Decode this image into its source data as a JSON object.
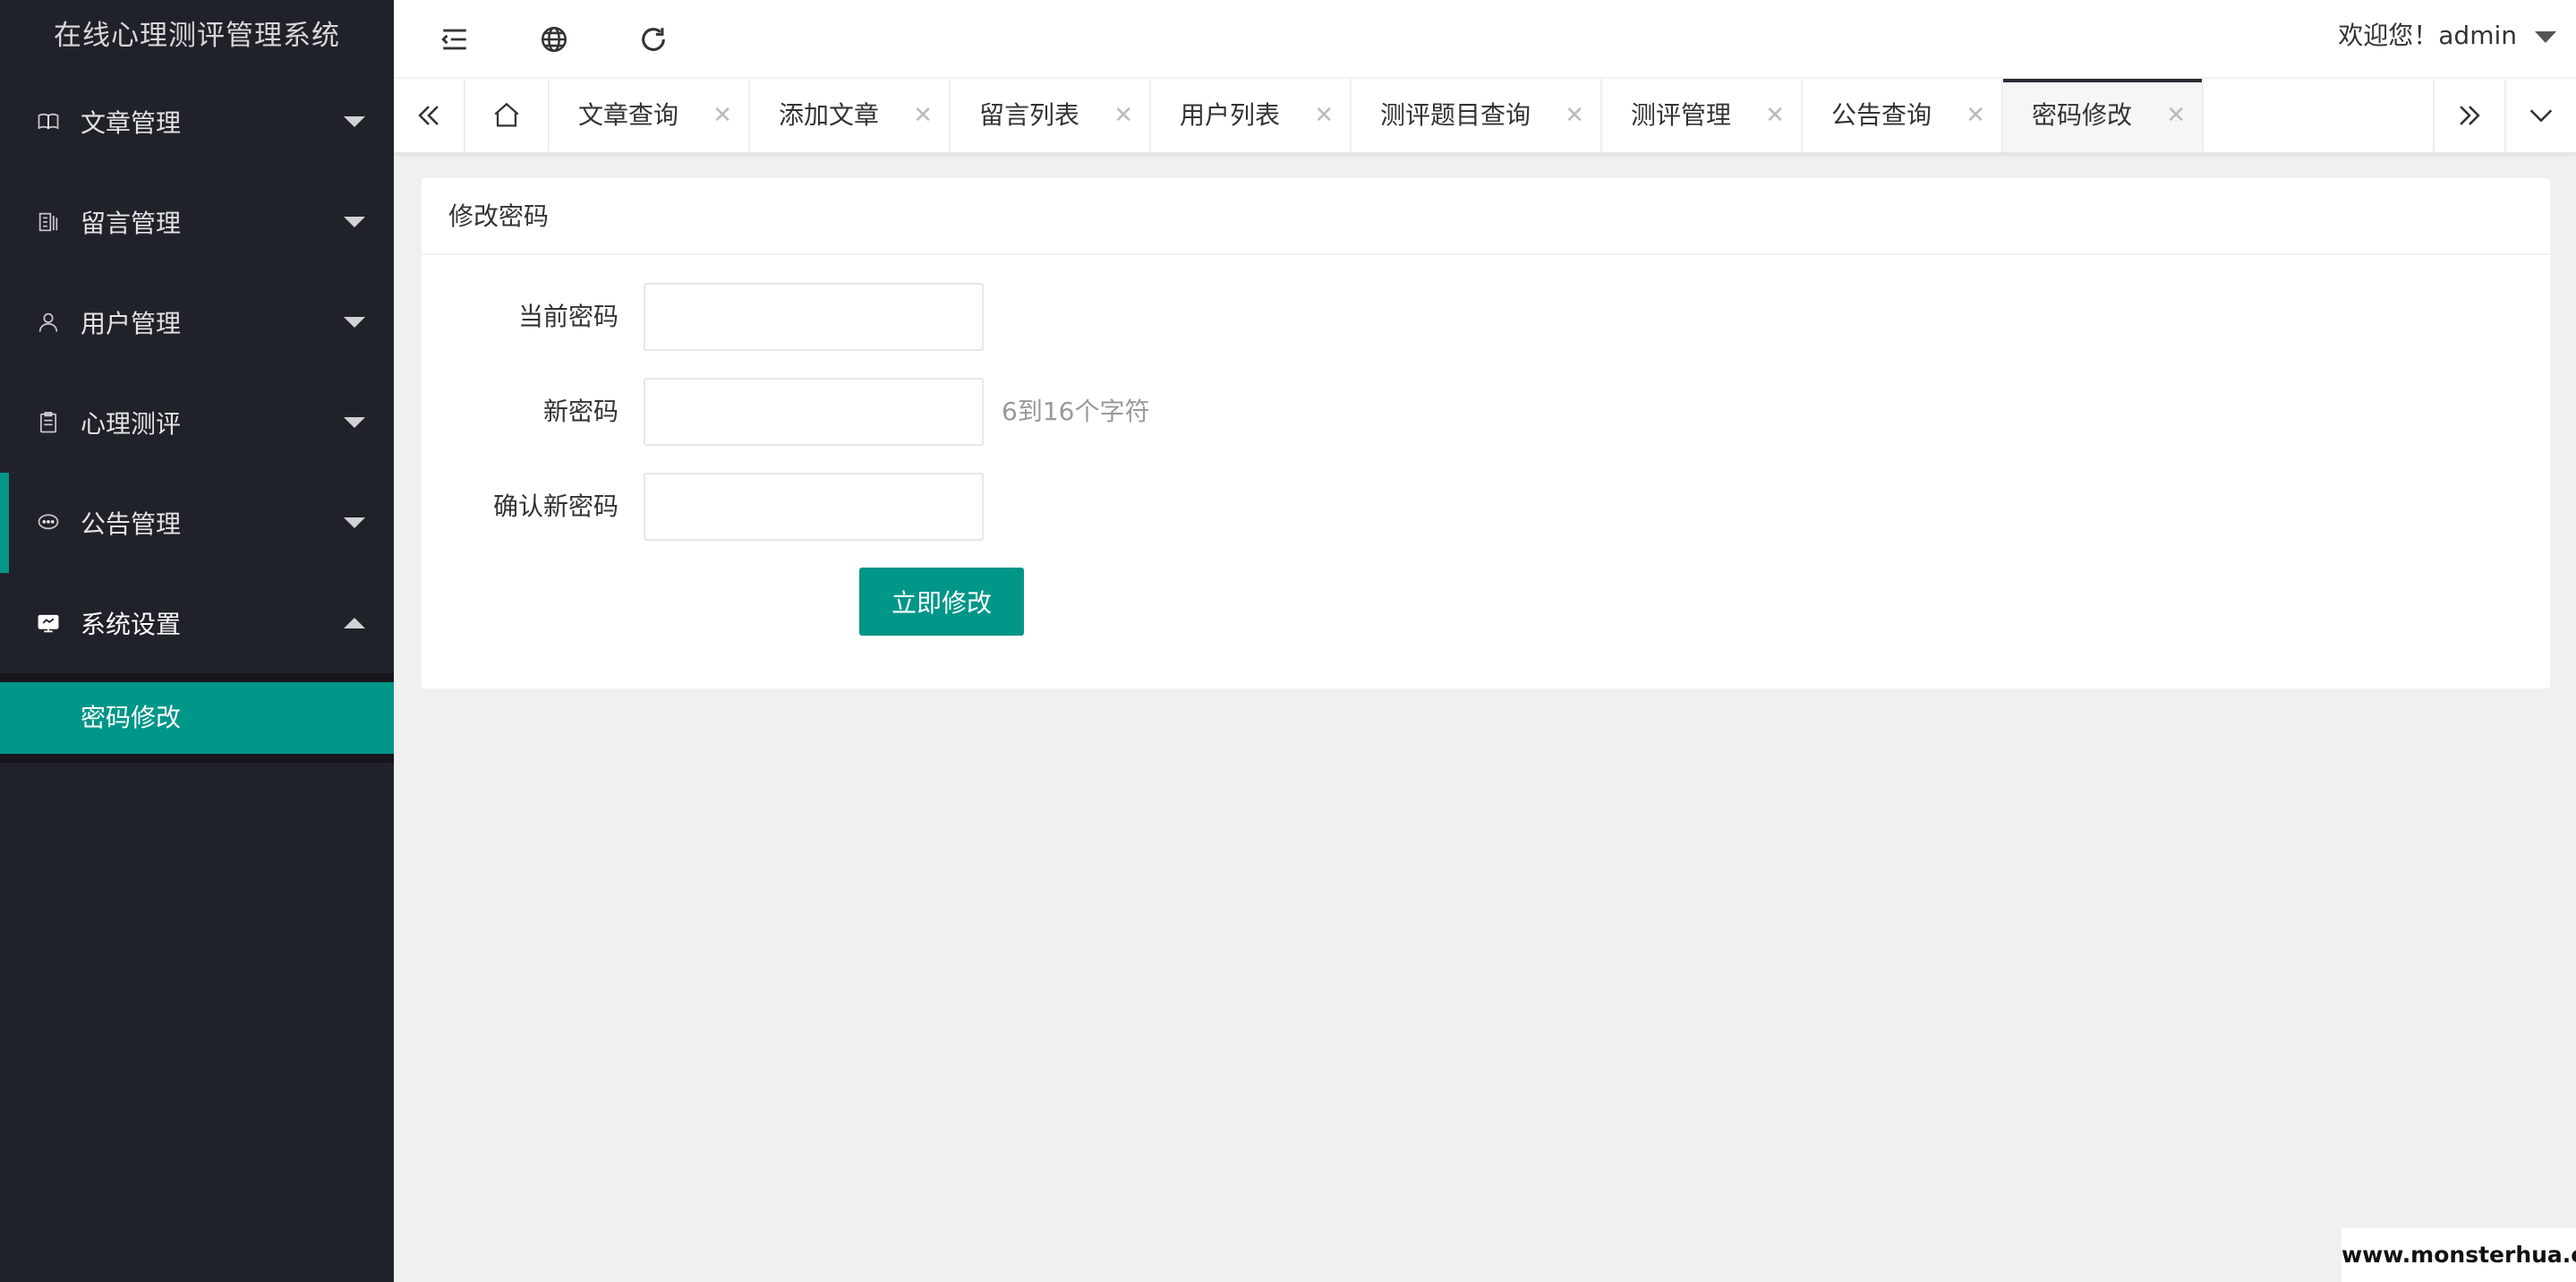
{
  "app": {
    "title": "在线心理测评管理系统"
  },
  "sidebar": {
    "items": [
      {
        "label": "文章管理",
        "icon": "book-icon",
        "expanded": false
      },
      {
        "label": "留言管理",
        "icon": "message-board-icon",
        "expanded": false
      },
      {
        "label": "用户管理",
        "icon": "user-icon",
        "expanded": false
      },
      {
        "label": "心理测评",
        "icon": "clipboard-icon",
        "expanded": false
      },
      {
        "label": "公告管理",
        "icon": "chat-icon",
        "expanded": false
      },
      {
        "label": "系统设置",
        "icon": "settings-panel-icon",
        "expanded": true
      }
    ],
    "subitems": [
      {
        "label": "密码修改",
        "active": true
      }
    ]
  },
  "header": {
    "welcome": "欢迎您！admin",
    "icons": [
      "menu-fold-icon",
      "globe-icon",
      "refresh-icon"
    ]
  },
  "tabs": {
    "items": [
      {
        "label": "文章查询",
        "close": "✕"
      },
      {
        "label": "添加文章",
        "close": "✕"
      },
      {
        "label": "留言列表",
        "close": "✕"
      },
      {
        "label": "用户列表",
        "close": "✕"
      },
      {
        "label": "测评题目查询",
        "close": "✕"
      },
      {
        "label": "测评管理",
        "close": "✕"
      },
      {
        "label": "公告查询",
        "close": "✕"
      },
      {
        "label": "密码修改",
        "close": "✕",
        "active": true
      }
    ]
  },
  "form": {
    "title": "修改密码",
    "fields": [
      {
        "label": "当前密码",
        "value": "",
        "hint": ""
      },
      {
        "label": "新密码",
        "value": "",
        "hint": "6到16个字符"
      },
      {
        "label": "确认新密码",
        "value": "",
        "hint": ""
      }
    ],
    "submit_label": "立即修改"
  },
  "watermark": "www.monsterhua.com",
  "colors": {
    "accent": "#009688",
    "sidebar_bg": "#20222a",
    "page_bg": "#f0f0f0"
  }
}
